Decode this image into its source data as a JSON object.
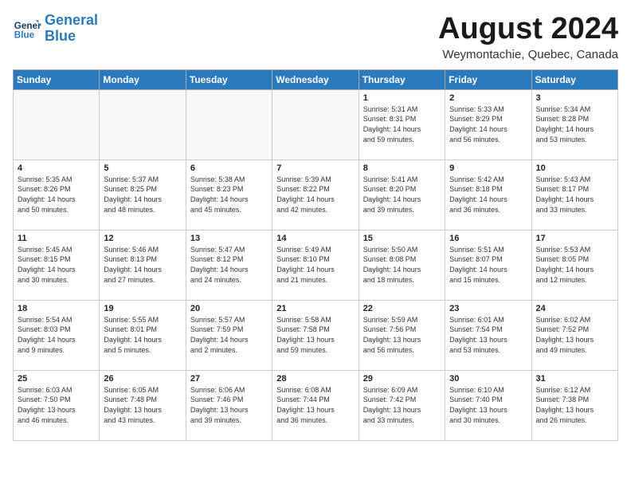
{
  "header": {
    "logo_line1": "General",
    "logo_line2": "Blue",
    "month": "August 2024",
    "location": "Weymontachie, Quebec, Canada"
  },
  "weekdays": [
    "Sunday",
    "Monday",
    "Tuesday",
    "Wednesday",
    "Thursday",
    "Friday",
    "Saturday"
  ],
  "weeks": [
    [
      {
        "day": "",
        "info": ""
      },
      {
        "day": "",
        "info": ""
      },
      {
        "day": "",
        "info": ""
      },
      {
        "day": "",
        "info": ""
      },
      {
        "day": "1",
        "info": "Sunrise: 5:31 AM\nSunset: 8:31 PM\nDaylight: 14 hours\nand 59 minutes."
      },
      {
        "day": "2",
        "info": "Sunrise: 5:33 AM\nSunset: 8:29 PM\nDaylight: 14 hours\nand 56 minutes."
      },
      {
        "day": "3",
        "info": "Sunrise: 5:34 AM\nSunset: 8:28 PM\nDaylight: 14 hours\nand 53 minutes."
      }
    ],
    [
      {
        "day": "4",
        "info": "Sunrise: 5:35 AM\nSunset: 8:26 PM\nDaylight: 14 hours\nand 50 minutes."
      },
      {
        "day": "5",
        "info": "Sunrise: 5:37 AM\nSunset: 8:25 PM\nDaylight: 14 hours\nand 48 minutes."
      },
      {
        "day": "6",
        "info": "Sunrise: 5:38 AM\nSunset: 8:23 PM\nDaylight: 14 hours\nand 45 minutes."
      },
      {
        "day": "7",
        "info": "Sunrise: 5:39 AM\nSunset: 8:22 PM\nDaylight: 14 hours\nand 42 minutes."
      },
      {
        "day": "8",
        "info": "Sunrise: 5:41 AM\nSunset: 8:20 PM\nDaylight: 14 hours\nand 39 minutes."
      },
      {
        "day": "9",
        "info": "Sunrise: 5:42 AM\nSunset: 8:18 PM\nDaylight: 14 hours\nand 36 minutes."
      },
      {
        "day": "10",
        "info": "Sunrise: 5:43 AM\nSunset: 8:17 PM\nDaylight: 14 hours\nand 33 minutes."
      }
    ],
    [
      {
        "day": "11",
        "info": "Sunrise: 5:45 AM\nSunset: 8:15 PM\nDaylight: 14 hours\nand 30 minutes."
      },
      {
        "day": "12",
        "info": "Sunrise: 5:46 AM\nSunset: 8:13 PM\nDaylight: 14 hours\nand 27 minutes."
      },
      {
        "day": "13",
        "info": "Sunrise: 5:47 AM\nSunset: 8:12 PM\nDaylight: 14 hours\nand 24 minutes."
      },
      {
        "day": "14",
        "info": "Sunrise: 5:49 AM\nSunset: 8:10 PM\nDaylight: 14 hours\nand 21 minutes."
      },
      {
        "day": "15",
        "info": "Sunrise: 5:50 AM\nSunset: 8:08 PM\nDaylight: 14 hours\nand 18 minutes."
      },
      {
        "day": "16",
        "info": "Sunrise: 5:51 AM\nSunset: 8:07 PM\nDaylight: 14 hours\nand 15 minutes."
      },
      {
        "day": "17",
        "info": "Sunrise: 5:53 AM\nSunset: 8:05 PM\nDaylight: 14 hours\nand 12 minutes."
      }
    ],
    [
      {
        "day": "18",
        "info": "Sunrise: 5:54 AM\nSunset: 8:03 PM\nDaylight: 14 hours\nand 9 minutes."
      },
      {
        "day": "19",
        "info": "Sunrise: 5:55 AM\nSunset: 8:01 PM\nDaylight: 14 hours\nand 5 minutes."
      },
      {
        "day": "20",
        "info": "Sunrise: 5:57 AM\nSunset: 7:59 PM\nDaylight: 14 hours\nand 2 minutes."
      },
      {
        "day": "21",
        "info": "Sunrise: 5:58 AM\nSunset: 7:58 PM\nDaylight: 13 hours\nand 59 minutes."
      },
      {
        "day": "22",
        "info": "Sunrise: 5:59 AM\nSunset: 7:56 PM\nDaylight: 13 hours\nand 56 minutes."
      },
      {
        "day": "23",
        "info": "Sunrise: 6:01 AM\nSunset: 7:54 PM\nDaylight: 13 hours\nand 53 minutes."
      },
      {
        "day": "24",
        "info": "Sunrise: 6:02 AM\nSunset: 7:52 PM\nDaylight: 13 hours\nand 49 minutes."
      }
    ],
    [
      {
        "day": "25",
        "info": "Sunrise: 6:03 AM\nSunset: 7:50 PM\nDaylight: 13 hours\nand 46 minutes."
      },
      {
        "day": "26",
        "info": "Sunrise: 6:05 AM\nSunset: 7:48 PM\nDaylight: 13 hours\nand 43 minutes."
      },
      {
        "day": "27",
        "info": "Sunrise: 6:06 AM\nSunset: 7:46 PM\nDaylight: 13 hours\nand 39 minutes."
      },
      {
        "day": "28",
        "info": "Sunrise: 6:08 AM\nSunset: 7:44 PM\nDaylight: 13 hours\nand 36 minutes."
      },
      {
        "day": "29",
        "info": "Sunrise: 6:09 AM\nSunset: 7:42 PM\nDaylight: 13 hours\nand 33 minutes."
      },
      {
        "day": "30",
        "info": "Sunrise: 6:10 AM\nSunset: 7:40 PM\nDaylight: 13 hours\nand 30 minutes."
      },
      {
        "day": "31",
        "info": "Sunrise: 6:12 AM\nSunset: 7:38 PM\nDaylight: 13 hours\nand 26 minutes."
      }
    ]
  ]
}
